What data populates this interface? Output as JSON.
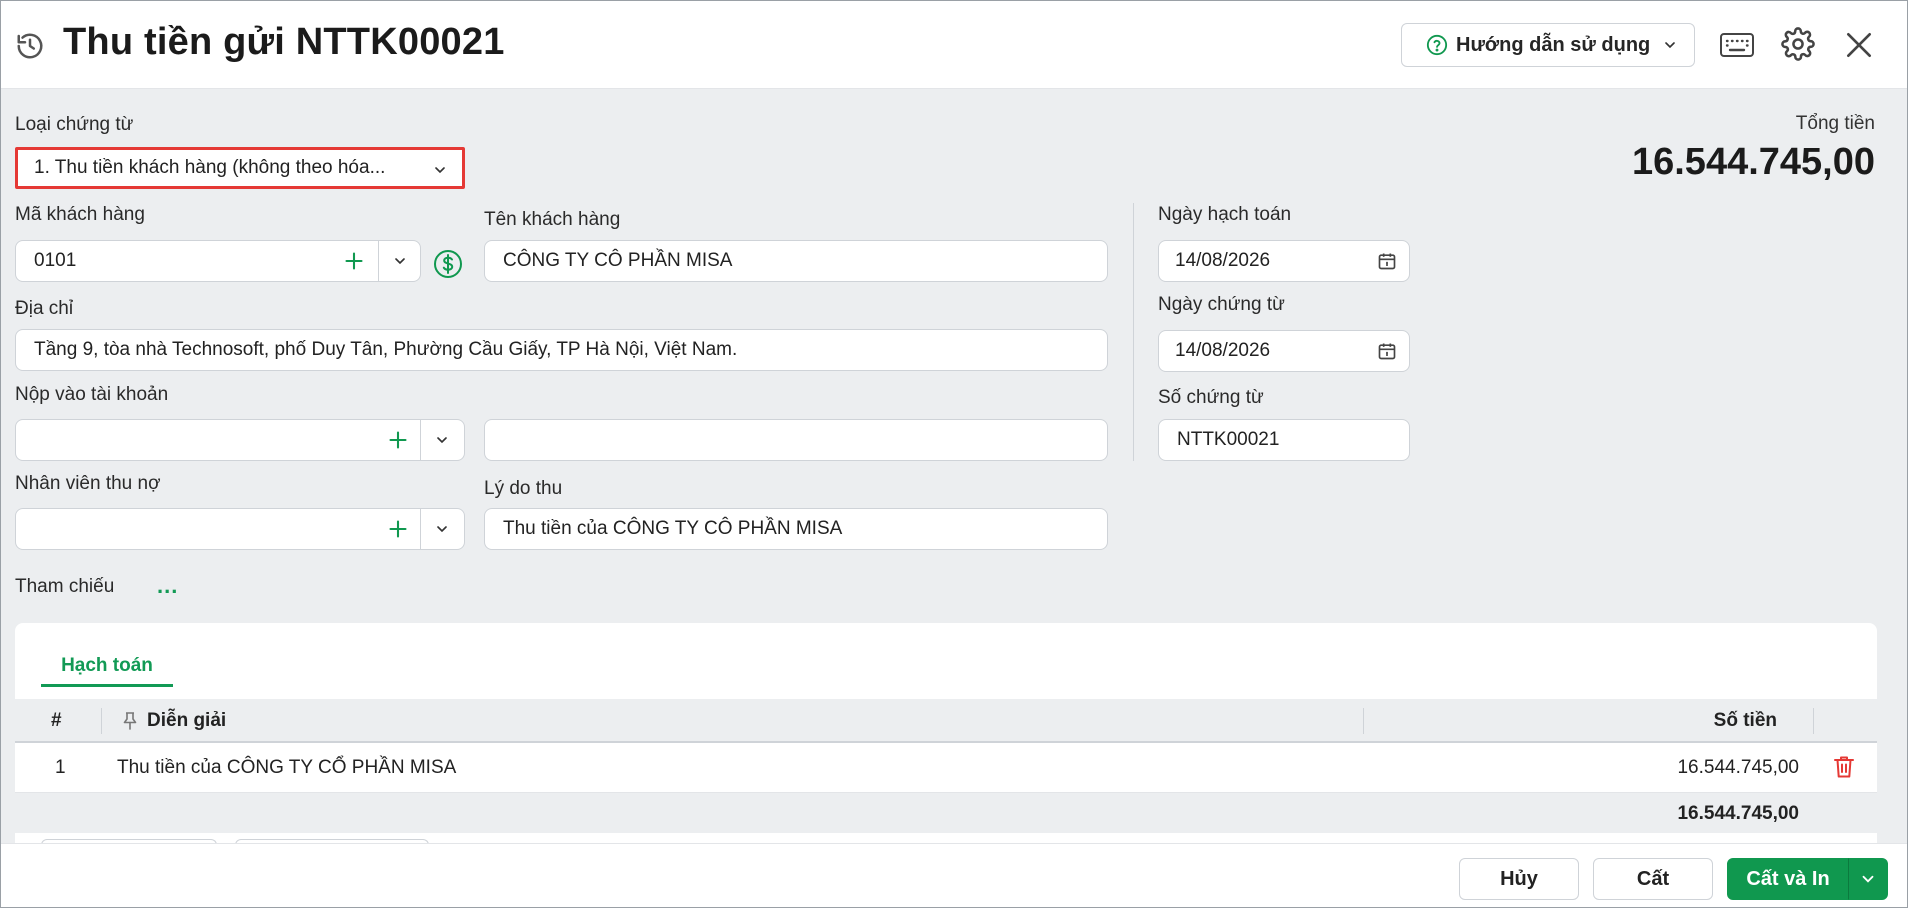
{
  "header": {
    "title": "Thu tiền gửi NTTK00021",
    "help_label": "Hướng dẫn sử dụng",
    "icons": [
      "history-icon",
      "help-icon",
      "chevron-down-icon",
      "keyboard-icon",
      "gear-icon",
      "close-icon"
    ]
  },
  "form": {
    "voucher_type_label": "Loại chứng từ",
    "voucher_type_value": "1. Thu tiền khách hàng (không theo hóa...",
    "total_label": "Tổng tiền",
    "total_value": "16.544.745,00",
    "customer_code_label": "Mã khách hàng",
    "customer_code_value": "0101",
    "customer_name_label": "Tên khách hàng",
    "customer_name_value": "CÔNG TY CÔ PHẦN MISA",
    "address_label": "Địa chỉ",
    "address_value": "Tầng 9, tòa nhà Technosoft, phố Duy Tân, Phường Cầu Giấy, TP Hà Nội, Việt Nam.",
    "deposit_account_label": "Nộp vào tài khoản",
    "deposit_account_value": "",
    "deposit_account_name": "",
    "collector_label": "Nhân viên thu nợ",
    "collector_value": "",
    "reason_label": "Lý do thu",
    "reason_value": "Thu tiền của CÔNG TY CÔ PHẦN MISA",
    "posting_date_label": "Ngày hạch toán",
    "posting_date_value": "14/08/2026",
    "voucher_date_label": "Ngày chứng từ",
    "voucher_date_value": "14/08/2026",
    "voucher_no_label": "Số chứng từ",
    "voucher_no_value": "NTTK00021",
    "reference_label": "Tham chiếu",
    "reference_more": "..."
  },
  "grid": {
    "tab_label": "Hạch toán",
    "columns": {
      "index": "#",
      "description": "Diễn giải",
      "amount": "Số tiền"
    },
    "rows": [
      {
        "index": "1",
        "description": "Thu tiền của CÔNG TY CỔ PHẦN MISA",
        "amount": "16.544.745,00"
      }
    ],
    "footer_total": "16.544.745,00"
  },
  "footer": {
    "cancel_label": "Hủy",
    "save_label": "Cất",
    "save_print_label": "Cất và In"
  },
  "colors": {
    "accent": "#10984f",
    "error_border": "#e53935",
    "delete": "#e53935"
  }
}
